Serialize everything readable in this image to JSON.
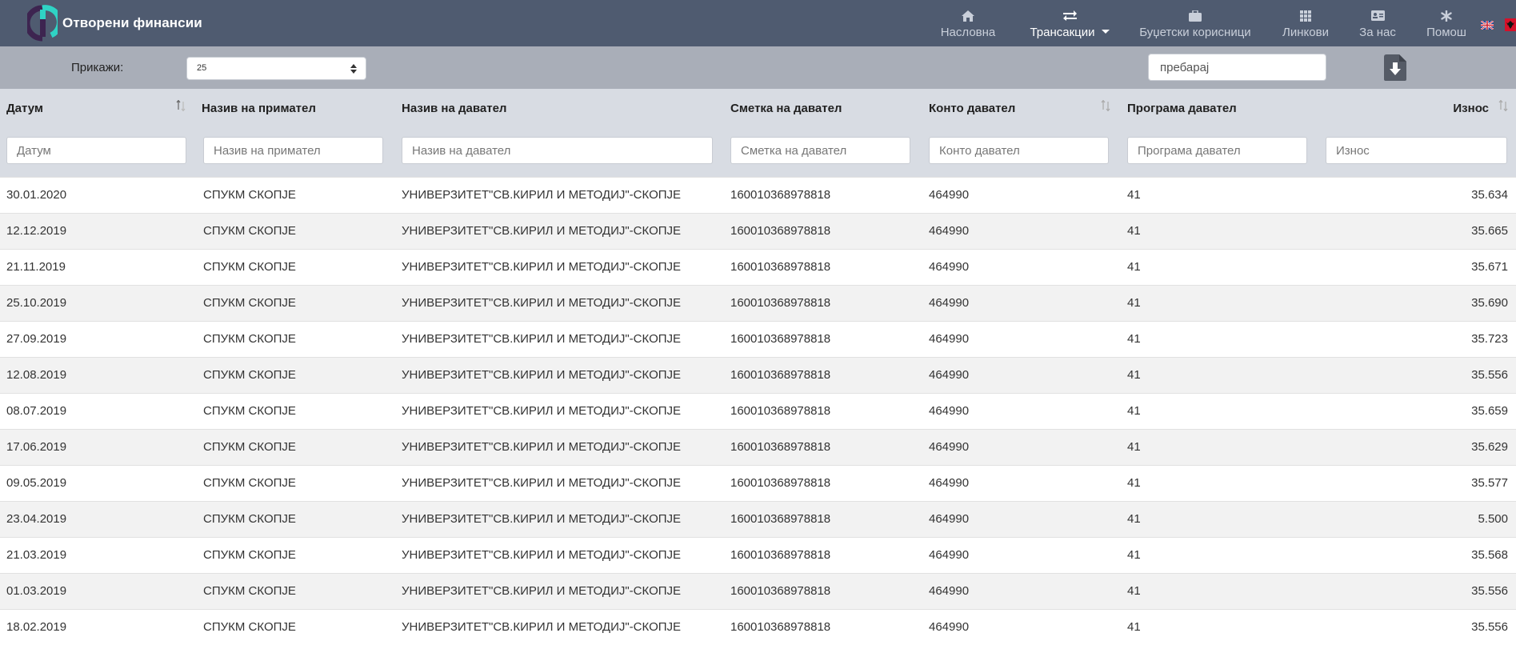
{
  "brand": {
    "title": "Отворени финансии"
  },
  "nav": [
    {
      "label": "Насловна",
      "icon": "home-icon",
      "active": false
    },
    {
      "label": "Трансакции",
      "icon": "exchange-icon",
      "active": true
    },
    {
      "label": "Буџетски корисници",
      "icon": "briefcase-icon",
      "active": false
    },
    {
      "label": "Линкови",
      "icon": "grid-icon",
      "active": false
    },
    {
      "label": "За нас",
      "icon": "id-card-icon",
      "active": false
    },
    {
      "label": "Помош",
      "icon": "asterisk-icon",
      "active": false
    }
  ],
  "toolbar": {
    "show_label": "Прикажи:",
    "page_size": "25",
    "search_placeholder": "пребарај"
  },
  "table": {
    "columns": [
      "Датум",
      "Назив на примател",
      "Назив на давател",
      "Сметка на давател",
      "Конто давател",
      "Програма давател",
      "Износ"
    ],
    "filters": [
      "Датум",
      "Назив на примател",
      "Назив на давател",
      "Сметка на давател",
      "Конто давател",
      "Програма давател",
      "Износ"
    ],
    "rows": [
      [
        "30.01.2020",
        "СПУКМ СКОПЈЕ",
        "УНИВЕРЗИТЕТ\"СВ.КИРИЛ И МЕТОДИЈ\"-СКОПЈЕ",
        "160010368978818",
        "464990",
        "41",
        "35.634"
      ],
      [
        "12.12.2019",
        "СПУКМ СКОПЈЕ",
        "УНИВЕРЗИТЕТ\"СВ.КИРИЛ И МЕТОДИЈ\"-СКОПЈЕ",
        "160010368978818",
        "464990",
        "41",
        "35.665"
      ],
      [
        "21.11.2019",
        "СПУКМ СКОПЈЕ",
        "УНИВЕРЗИТЕТ\"СВ.КИРИЛ И МЕТОДИЈ\"-СКОПЈЕ",
        "160010368978818",
        "464990",
        "41",
        "35.671"
      ],
      [
        "25.10.2019",
        "СПУКМ СКОПЈЕ",
        "УНИВЕРЗИТЕТ\"СВ.КИРИЛ И МЕТОДИЈ\"-СКОПЈЕ",
        "160010368978818",
        "464990",
        "41",
        "35.690"
      ],
      [
        "27.09.2019",
        "СПУКМ СКОПЈЕ",
        "УНИВЕРЗИТЕТ\"СВ.КИРИЛ И МЕТОДИЈ\"-СКОПЈЕ",
        "160010368978818",
        "464990",
        "41",
        "35.723"
      ],
      [
        "12.08.2019",
        "СПУКМ СКОПЈЕ",
        "УНИВЕРЗИТЕТ\"СВ.КИРИЛ И МЕТОДИЈ\"-СКОПЈЕ",
        "160010368978818",
        "464990",
        "41",
        "35.556"
      ],
      [
        "08.07.2019",
        "СПУКМ СКОПЈЕ",
        "УНИВЕРЗИТЕТ\"СВ.КИРИЛ И МЕТОДИЈ\"-СКОПЈЕ",
        "160010368978818",
        "464990",
        "41",
        "35.659"
      ],
      [
        "17.06.2019",
        "СПУКМ СКОПЈЕ",
        "УНИВЕРЗИТЕТ\"СВ.КИРИЛ И МЕТОДИЈ\"-СКОПЈЕ",
        "160010368978818",
        "464990",
        "41",
        "35.629"
      ],
      [
        "09.05.2019",
        "СПУКМ СКОПЈЕ",
        "УНИВЕРЗИТЕТ\"СВ.КИРИЛ И МЕТОДИЈ\"-СКОПЈЕ",
        "160010368978818",
        "464990",
        "41",
        "35.577"
      ],
      [
        "23.04.2019",
        "СПУКМ СКОПЈЕ",
        "УНИВЕРЗИТЕТ\"СВ.КИРИЛ И МЕТОДИЈ\"-СКОПЈЕ",
        "160010368978818",
        "464990",
        "41",
        "5.500"
      ],
      [
        "21.03.2019",
        "СПУКМ СКОПЈЕ",
        "УНИВЕРЗИТЕТ\"СВ.КИРИЛ И МЕТОДИЈ\"-СКОПЈЕ",
        "160010368978818",
        "464990",
        "41",
        "35.568"
      ],
      [
        "01.03.2019",
        "СПУКМ СКОПЈЕ",
        "УНИВЕРЗИТЕТ\"СВ.КИРИЛ И МЕТОДИЈ\"-СКОПЈЕ",
        "160010368978818",
        "464990",
        "41",
        "35.556"
      ],
      [
        "18.02.2019",
        "СПУКМ СКОПЈЕ",
        "УНИВЕРЗИТЕТ\"СВ.КИРИЛ И МЕТОДИЈ\"-СКОПЈЕ",
        "160010368978818",
        "464990",
        "41",
        "35.556"
      ]
    ]
  },
  "colors": {
    "navbar": "#4f5b70",
    "toolbar": "#a9aeb8",
    "table_head": "#d8dce3",
    "brand_accent": "#2fd3c5",
    "brand_primary": "#4b2a55"
  }
}
